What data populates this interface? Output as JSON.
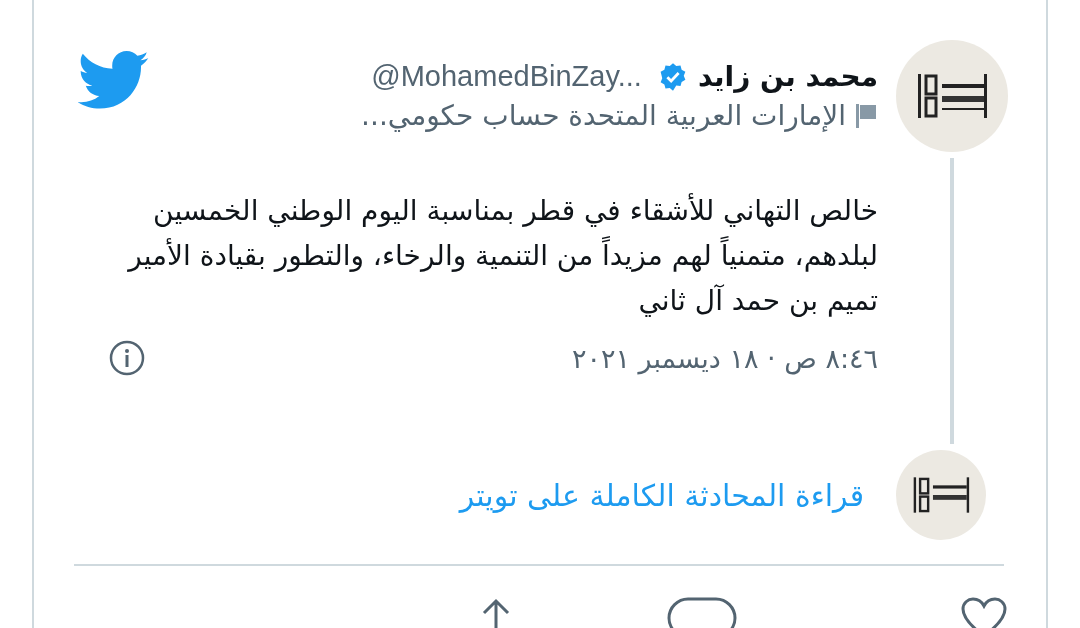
{
  "author": {
    "name": "محمد بن زايد",
    "verified": true,
    "handle": "@MohamedBinZay...",
    "label": "الإمارات العربية المتحدة حساب حكومي..."
  },
  "tweet": {
    "text": "خالص التهاني للأشقاء في قطر بمناسبة اليوم الوطني الخمسين لبلدهم، متمنياً لهم مزيداً من التنمية والرخاء، والتطور  بقيادة الأمير تميم بن حمد آل ثاني",
    "timestamp": "٨:٤٦ ص · ١٨ ديسمبر ٢٠٢١"
  },
  "thread_link": "قراءة المحادثة الكاملة على تويتر"
}
